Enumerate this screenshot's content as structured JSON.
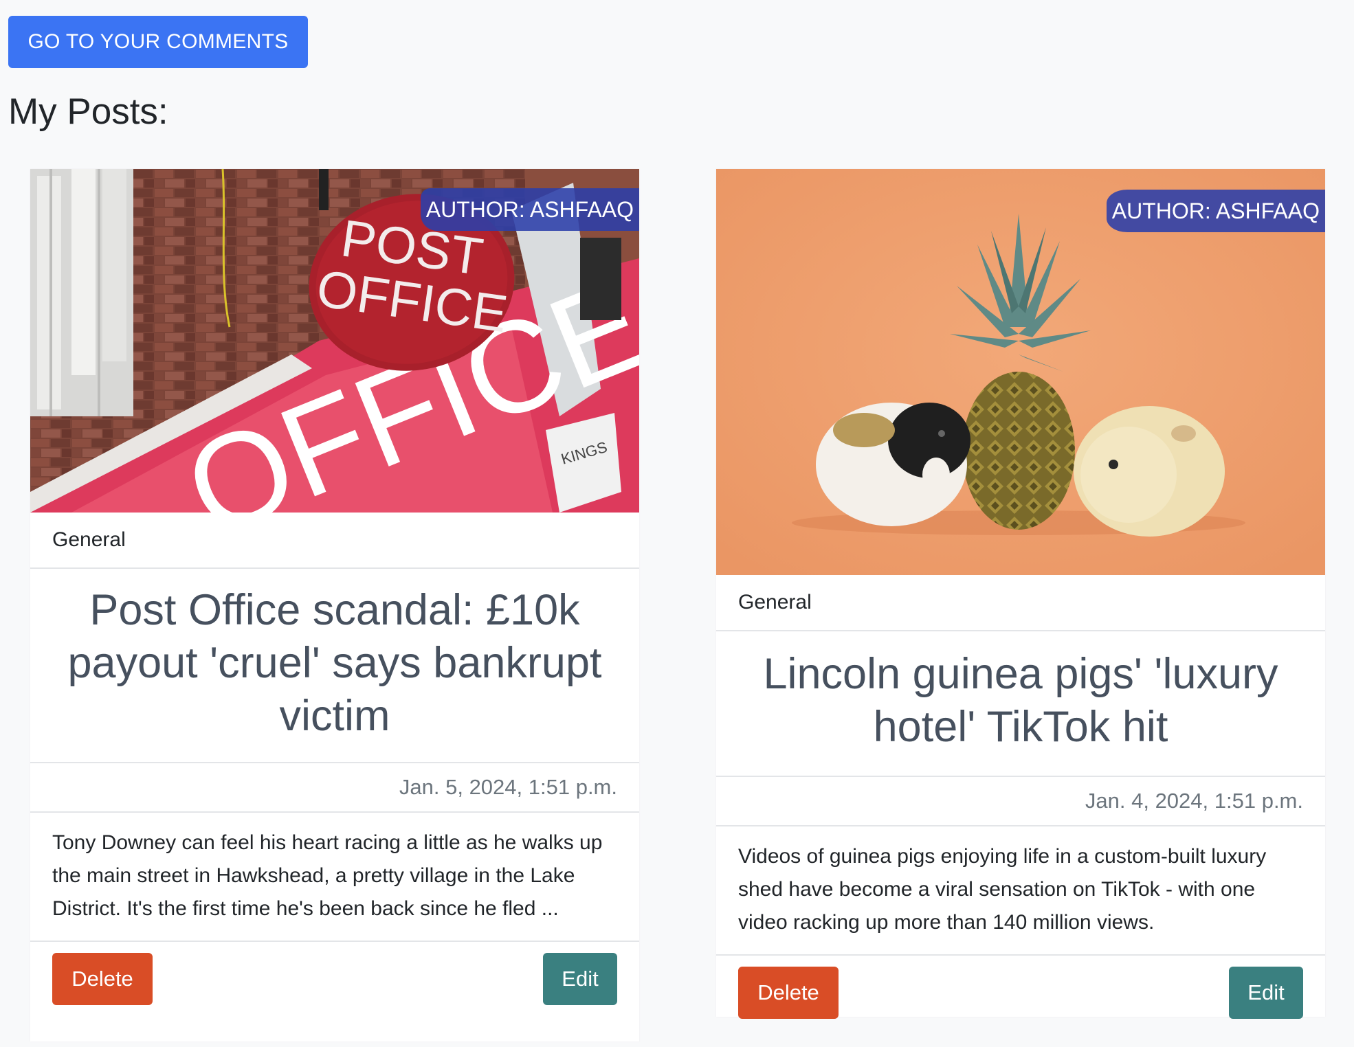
{
  "header": {
    "comments_button": "GO TO YOUR COMMENTS",
    "page_title": "My Posts:"
  },
  "posts": [
    {
      "author_badge": "AUTHOR: ASHFAAQ",
      "category": "General",
      "title": "Post Office scandal: £10k payout 'cruel' says bankrupt victim",
      "date": "Jan. 5, 2024, 1:51 p.m.",
      "excerpt": "Tony Downey can feel his heart racing a little as he walks up the main street in Hawkshead, a pretty village in the Lake District. It's the first time he's been back since he fled ...",
      "delete_label": "Delete",
      "edit_label": "Edit",
      "image": {
        "sign_text_line1": "POST",
        "sign_text_line2": "OFFICE",
        "facia_text": "OFFICE",
        "alarm_text": "KINGS"
      }
    },
    {
      "author_badge": "AUTHOR: ASHFAAQ",
      "category": "General",
      "title": "Lincoln guinea pigs' 'luxury hotel' TikTok hit",
      "date": "Jan. 4, 2024, 1:51 p.m.",
      "excerpt": "Videos of guinea pigs enjoying life in a custom-built luxury shed have become a viral sensation on TikTok - with one video racking up more than 140 million views.",
      "delete_label": "Delete",
      "edit_label": "Edit"
    }
  ],
  "colors": {
    "primary": "#3b74f3",
    "danger": "#d94d26",
    "edit": "#3a8080",
    "badge": "#2b3faa"
  }
}
